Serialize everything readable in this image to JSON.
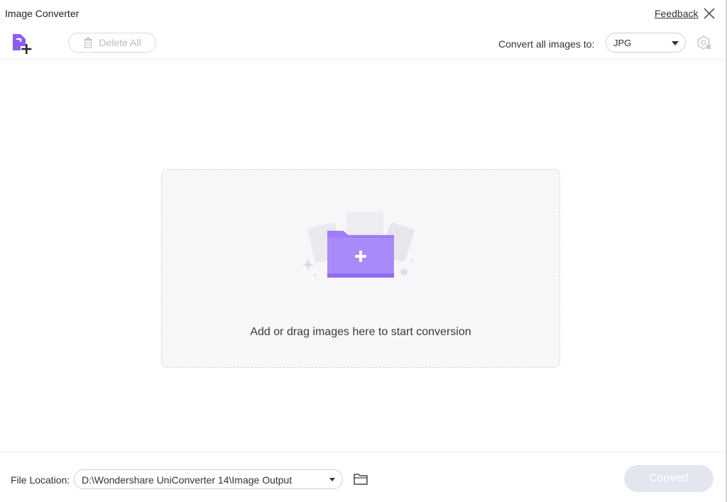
{
  "window": {
    "title": "Image Converter",
    "feedback_label": "Feedback"
  },
  "toolbar": {
    "delete_all_label": "Delete All",
    "convert_all_label": "Convert all images to:",
    "format_value": "JPG"
  },
  "main": {
    "drop_text": "Add or drag images here to start conversion"
  },
  "footer": {
    "file_location_label": "File Location:",
    "file_location_value": "D:\\Wondershare UniConverter 14\\Image Output",
    "convert_label": "Convert"
  },
  "colors": {
    "accent_purple": "#8b5cf6",
    "folder_purple": "#a07cf7",
    "disabled_button": "#e3e6ef",
    "drop_zone_bg": "#f7f7fa"
  },
  "icons": {
    "add_file": "add-file-icon",
    "trash": "trash-icon",
    "close": "close-icon",
    "settings": "settings-icon",
    "folder_add": "folder-add-icon",
    "open_folder": "folder-icon",
    "chevron": "chevron-down-icon"
  }
}
